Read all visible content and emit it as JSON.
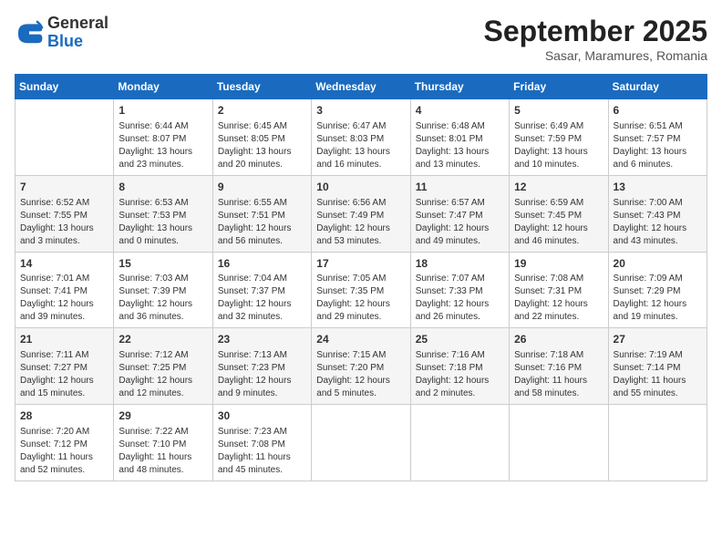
{
  "header": {
    "logo_line1": "General",
    "logo_line2": "Blue",
    "month": "September 2025",
    "location": "Sasar, Maramures, Romania"
  },
  "weekdays": [
    "Sunday",
    "Monday",
    "Tuesday",
    "Wednesday",
    "Thursday",
    "Friday",
    "Saturday"
  ],
  "weeks": [
    [
      {
        "day": "",
        "info": ""
      },
      {
        "day": "1",
        "info": "Sunrise: 6:44 AM\nSunset: 8:07 PM\nDaylight: 13 hours\nand 23 minutes."
      },
      {
        "day": "2",
        "info": "Sunrise: 6:45 AM\nSunset: 8:05 PM\nDaylight: 13 hours\nand 20 minutes."
      },
      {
        "day": "3",
        "info": "Sunrise: 6:47 AM\nSunset: 8:03 PM\nDaylight: 13 hours\nand 16 minutes."
      },
      {
        "day": "4",
        "info": "Sunrise: 6:48 AM\nSunset: 8:01 PM\nDaylight: 13 hours\nand 13 minutes."
      },
      {
        "day": "5",
        "info": "Sunrise: 6:49 AM\nSunset: 7:59 PM\nDaylight: 13 hours\nand 10 minutes."
      },
      {
        "day": "6",
        "info": "Sunrise: 6:51 AM\nSunset: 7:57 PM\nDaylight: 13 hours\nand 6 minutes."
      }
    ],
    [
      {
        "day": "7",
        "info": "Sunrise: 6:52 AM\nSunset: 7:55 PM\nDaylight: 13 hours\nand 3 minutes."
      },
      {
        "day": "8",
        "info": "Sunrise: 6:53 AM\nSunset: 7:53 PM\nDaylight: 13 hours\nand 0 minutes."
      },
      {
        "day": "9",
        "info": "Sunrise: 6:55 AM\nSunset: 7:51 PM\nDaylight: 12 hours\nand 56 minutes."
      },
      {
        "day": "10",
        "info": "Sunrise: 6:56 AM\nSunset: 7:49 PM\nDaylight: 12 hours\nand 53 minutes."
      },
      {
        "day": "11",
        "info": "Sunrise: 6:57 AM\nSunset: 7:47 PM\nDaylight: 12 hours\nand 49 minutes."
      },
      {
        "day": "12",
        "info": "Sunrise: 6:59 AM\nSunset: 7:45 PM\nDaylight: 12 hours\nand 46 minutes."
      },
      {
        "day": "13",
        "info": "Sunrise: 7:00 AM\nSunset: 7:43 PM\nDaylight: 12 hours\nand 43 minutes."
      }
    ],
    [
      {
        "day": "14",
        "info": "Sunrise: 7:01 AM\nSunset: 7:41 PM\nDaylight: 12 hours\nand 39 minutes."
      },
      {
        "day": "15",
        "info": "Sunrise: 7:03 AM\nSunset: 7:39 PM\nDaylight: 12 hours\nand 36 minutes."
      },
      {
        "day": "16",
        "info": "Sunrise: 7:04 AM\nSunset: 7:37 PM\nDaylight: 12 hours\nand 32 minutes."
      },
      {
        "day": "17",
        "info": "Sunrise: 7:05 AM\nSunset: 7:35 PM\nDaylight: 12 hours\nand 29 minutes."
      },
      {
        "day": "18",
        "info": "Sunrise: 7:07 AM\nSunset: 7:33 PM\nDaylight: 12 hours\nand 26 minutes."
      },
      {
        "day": "19",
        "info": "Sunrise: 7:08 AM\nSunset: 7:31 PM\nDaylight: 12 hours\nand 22 minutes."
      },
      {
        "day": "20",
        "info": "Sunrise: 7:09 AM\nSunset: 7:29 PM\nDaylight: 12 hours\nand 19 minutes."
      }
    ],
    [
      {
        "day": "21",
        "info": "Sunrise: 7:11 AM\nSunset: 7:27 PM\nDaylight: 12 hours\nand 15 minutes."
      },
      {
        "day": "22",
        "info": "Sunrise: 7:12 AM\nSunset: 7:25 PM\nDaylight: 12 hours\nand 12 minutes."
      },
      {
        "day": "23",
        "info": "Sunrise: 7:13 AM\nSunset: 7:23 PM\nDaylight: 12 hours\nand 9 minutes."
      },
      {
        "day": "24",
        "info": "Sunrise: 7:15 AM\nSunset: 7:20 PM\nDaylight: 12 hours\nand 5 minutes."
      },
      {
        "day": "25",
        "info": "Sunrise: 7:16 AM\nSunset: 7:18 PM\nDaylight: 12 hours\nand 2 minutes."
      },
      {
        "day": "26",
        "info": "Sunrise: 7:18 AM\nSunset: 7:16 PM\nDaylight: 11 hours\nand 58 minutes."
      },
      {
        "day": "27",
        "info": "Sunrise: 7:19 AM\nSunset: 7:14 PM\nDaylight: 11 hours\nand 55 minutes."
      }
    ],
    [
      {
        "day": "28",
        "info": "Sunrise: 7:20 AM\nSunset: 7:12 PM\nDaylight: 11 hours\nand 52 minutes."
      },
      {
        "day": "29",
        "info": "Sunrise: 7:22 AM\nSunset: 7:10 PM\nDaylight: 11 hours\nand 48 minutes."
      },
      {
        "day": "30",
        "info": "Sunrise: 7:23 AM\nSunset: 7:08 PM\nDaylight: 11 hours\nand 45 minutes."
      },
      {
        "day": "",
        "info": ""
      },
      {
        "day": "",
        "info": ""
      },
      {
        "day": "",
        "info": ""
      },
      {
        "day": "",
        "info": ""
      }
    ]
  ]
}
